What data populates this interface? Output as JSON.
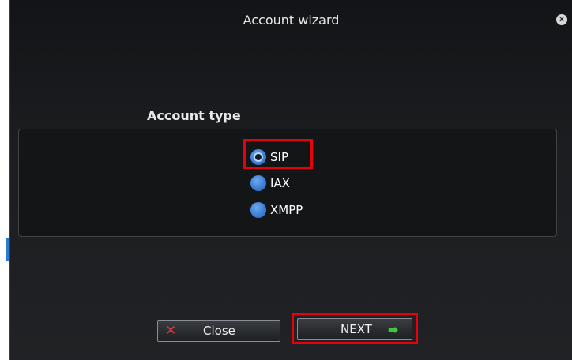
{
  "window": {
    "title": "Account wizard",
    "close_icon": "close-circle-icon"
  },
  "account_type": {
    "label": "Account type",
    "options": [
      {
        "label": "SIP",
        "selected": true
      },
      {
        "label": "IAX",
        "selected": false
      },
      {
        "label": "XMPP",
        "selected": false
      }
    ]
  },
  "buttons": {
    "close_label": "Close",
    "close_icon": "x-icon",
    "next_label": "NEXT",
    "next_icon": "arrow-right-icon"
  },
  "colors": {
    "background": "#1b1d20",
    "radio_blue": "#3d7fd6",
    "highlight_red": "#e8000d",
    "close_x_red": "#e8323a",
    "next_arrow_green": "#3ec83e"
  }
}
